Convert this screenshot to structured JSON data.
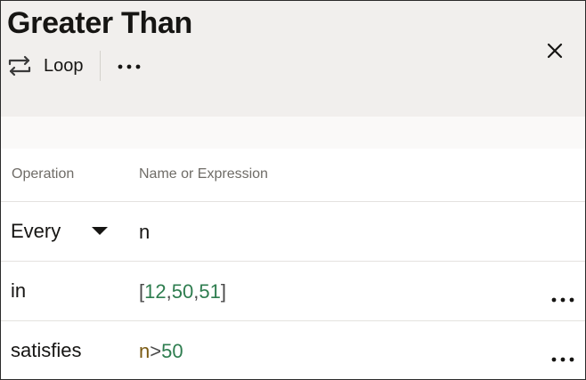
{
  "header": {
    "title": "Greater Than",
    "loop_label": "Loop",
    "icons": {
      "loop": "loop-arrows-icon",
      "more": "more-horizontal-icon",
      "close": "close-icon"
    }
  },
  "table": {
    "columns": [
      "Operation",
      "Name or Expression"
    ],
    "rows": [
      {
        "operation": "Every",
        "has_dropdown": true,
        "expression": {
          "text": "n"
        }
      },
      {
        "operation": "in",
        "expression": {
          "open": "[",
          "n1": "12",
          "c1": ",",
          "n2": "50",
          "c2": ",",
          "n3": "51",
          "close": "]"
        }
      },
      {
        "operation": "satisfies",
        "expression": {
          "var": "n",
          "op": ">",
          "num": "50"
        }
      }
    ]
  },
  "colors": {
    "header_bg": "#f1efed",
    "number_green": "#2e7d4f",
    "variable_brown": "#7a5a12"
  }
}
